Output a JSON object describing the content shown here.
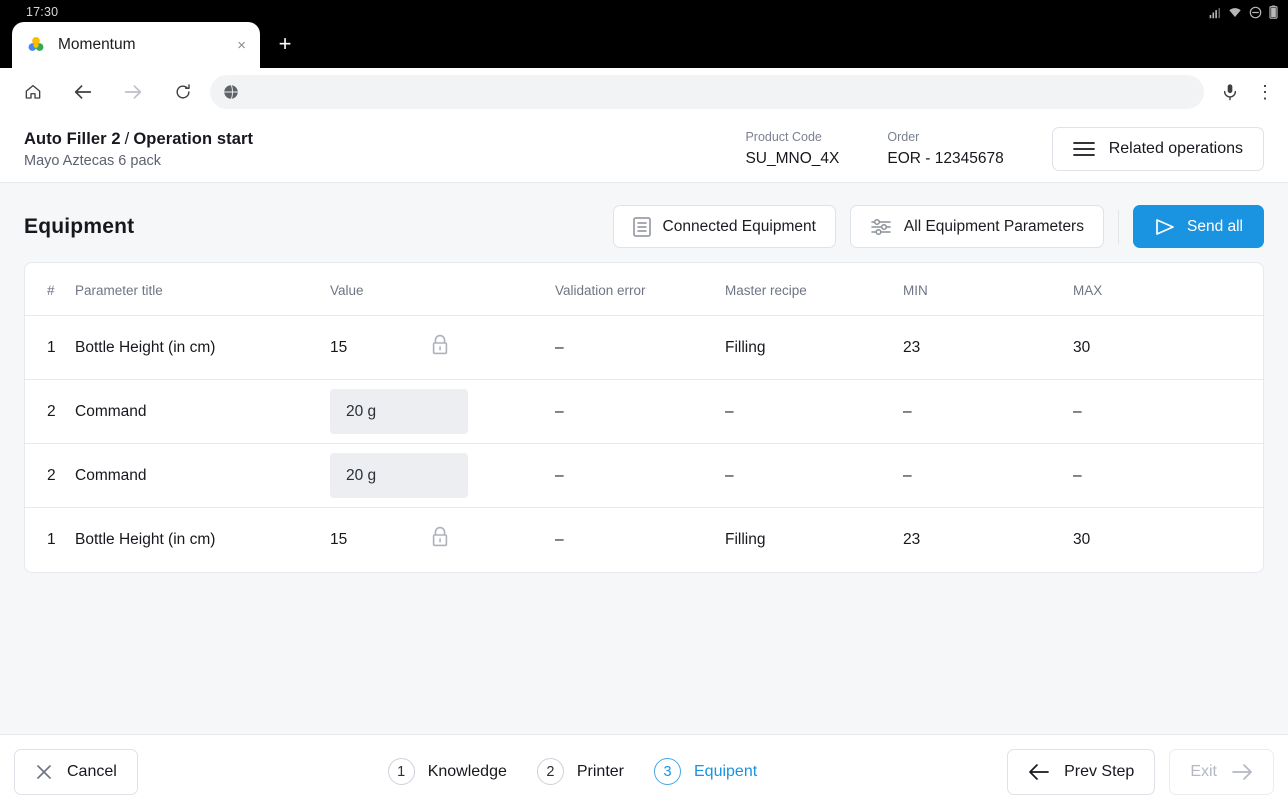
{
  "status_bar": {
    "time": "17:30",
    "icons": [
      "signal-icon",
      "wifi-icon",
      "dnd-icon",
      "battery-icon"
    ]
  },
  "browser": {
    "tab": {
      "title": "Momentum",
      "favicon": "momentum-clover-favicon",
      "close_label": "×"
    },
    "new_tab_label": "+",
    "omnibox": {
      "text": "",
      "placeholder": "",
      "site_icon": "globe-icon"
    },
    "nav": {
      "home": "home-icon",
      "back": "back-arrow-icon",
      "forward": "forward-arrow-icon",
      "reload": "reload-icon",
      "mic": "microphone-icon",
      "menu": "⋮"
    }
  },
  "header": {
    "title_main": "Auto Filler 2",
    "title_sep": "/",
    "title_step": "Operation start",
    "subtitle": "Mayo Aztecas 6 pack",
    "product_code_label": "Product Code",
    "product_code_value": "SU_MNO_4X",
    "order_label": "Order",
    "order_value": "EOR - 12345678",
    "related_operations_label": "Related operations"
  },
  "toolbar": {
    "section_title": "Equipment",
    "connected_equipment_label": "Connected Equipment",
    "all_parameters_label": "All Equipment Parameters",
    "send_all_label": "Send all"
  },
  "table": {
    "columns": [
      "#",
      "Parameter title",
      "Value",
      "Validation error",
      "Master recipe",
      "MIN",
      "MAX"
    ],
    "rows": [
      {
        "num": "1",
        "title": "Bottle Height (in cm)",
        "value": "15",
        "locked": true,
        "editable": false,
        "error": "–",
        "master_recipe": "Filling",
        "min": "23",
        "max": "30"
      },
      {
        "num": "2",
        "title": "Command",
        "value": "20 g",
        "locked": false,
        "editable": true,
        "error": "–",
        "master_recipe": "–",
        "min": "–",
        "max": "–"
      },
      {
        "num": "2",
        "title": "Command",
        "value": "20 g",
        "locked": false,
        "editable": true,
        "error": "–",
        "master_recipe": "–",
        "min": "–",
        "max": "–"
      },
      {
        "num": "1",
        "title": "Bottle Height (in cm)",
        "value": "15",
        "locked": true,
        "editable": false,
        "error": "–",
        "master_recipe": "Filling",
        "min": "23",
        "max": "30"
      }
    ]
  },
  "footer": {
    "cancel_label": "Cancel",
    "prev_step_label": "Prev Step",
    "exit_label": "Exit",
    "steps": [
      {
        "num": "1",
        "label": "Knowledge",
        "active": false
      },
      {
        "num": "2",
        "label": "Printer",
        "active": false
      },
      {
        "num": "3",
        "label": "Equipent",
        "active": true
      }
    ]
  },
  "colors": {
    "accent": "#1a93e0",
    "page_bg": "#f6f7f9",
    "card_bg": "#ffffff",
    "input_bg": "#eceef2",
    "border": "#e7e9ed",
    "muted_text": "#6f7583"
  }
}
